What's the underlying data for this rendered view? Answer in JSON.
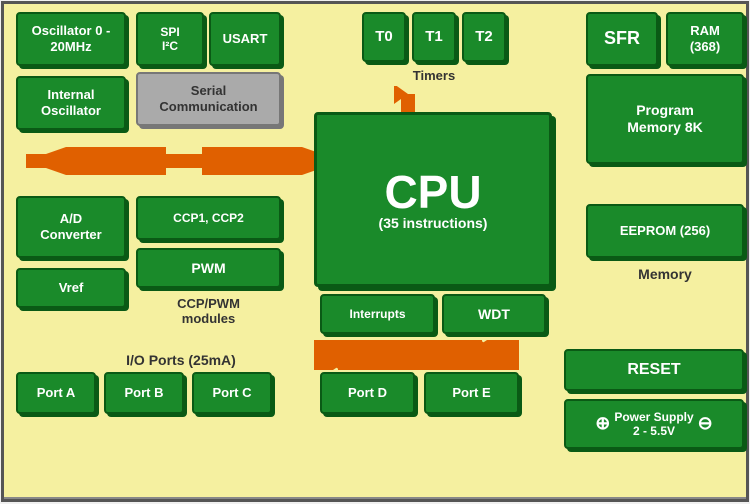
{
  "board": {
    "background": "#f5f0a0",
    "blocks": {
      "oscillator": {
        "label": "Oscillator\n0 - 20MHz"
      },
      "internal_oscillator": {
        "label": "Internal\nOscillator"
      },
      "spi_i2c": {
        "label": "SPI\nI²C"
      },
      "usart": {
        "label": "USART"
      },
      "serial_comm": {
        "label": "Serial\nCommunication"
      },
      "t0": {
        "label": "T0"
      },
      "t1": {
        "label": "T1"
      },
      "t2": {
        "label": "T2"
      },
      "timers": {
        "label": "Timers"
      },
      "sfr": {
        "label": "SFR"
      },
      "ram": {
        "label": "RAM\n(368)"
      },
      "program_memory": {
        "label": "Program\nMemory 8K"
      },
      "eeprom": {
        "label": "EEPROM (256)"
      },
      "memory": {
        "label": "Memory"
      },
      "cpu": {
        "label": "CPU",
        "sub": "(35 instructions)"
      },
      "interrupts": {
        "label": "Interrupts"
      },
      "wdt": {
        "label": "WDT"
      },
      "ad_converter": {
        "label": "A/D\nConverter"
      },
      "vref": {
        "label": "Vref"
      },
      "ccp1_ccp2": {
        "label": "CCP1, CCP2"
      },
      "pwm": {
        "label": "PWM"
      },
      "ccp_pwm": {
        "label": "CCP/PWM\nmodules"
      },
      "io_ports": {
        "label": "I/O Ports (25mA)"
      },
      "port_a": {
        "label": "Port A"
      },
      "port_b": {
        "label": "Port B"
      },
      "port_c": {
        "label": "Port C"
      },
      "port_d": {
        "label": "Port D"
      },
      "port_e": {
        "label": "Port E"
      },
      "reset": {
        "label": "RESET"
      },
      "power_supply": {
        "label": "Power Supply\n2 - 5.5V"
      }
    }
  }
}
